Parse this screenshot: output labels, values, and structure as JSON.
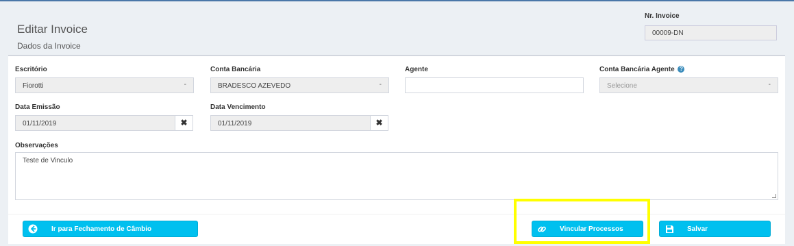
{
  "header": {
    "title": "Editar Invoice",
    "subtitle": "Dados da Invoice",
    "nr_invoice_label": "Nr. Invoice",
    "nr_invoice_value": "00009-DN"
  },
  "form": {
    "escritorio_label": "Escritório",
    "escritorio_value": "Fiorotti",
    "conta_bancaria_label": "Conta Bancária",
    "conta_bancaria_value": "BRADESCO AZEVEDO",
    "agente_label": "Agente",
    "agente_value": "",
    "conta_agente_label": "Conta Bancária Agente",
    "conta_agente_placeholder": "Selecione",
    "select_caret": "-",
    "data_emissao_label": "Data Emissão",
    "data_emissao_value": "01/11/2019",
    "data_vencimento_label": "Data Vencimento",
    "data_vencimento_value": "01/11/2019",
    "clear_glyph": "✖",
    "observacoes_label": "Observações",
    "observacoes_value": "Teste de Vinculo"
  },
  "footer": {
    "cambio_label": "Ir para Fechamento de Câmbio",
    "vincular_label": "Vincular Processos",
    "salvar_label": "Salvar"
  },
  "icons": {
    "help": "help-icon",
    "back": "arrow-left-circle-icon",
    "link": "link-icon",
    "save": "floppy-disk-icon"
  },
  "colors": {
    "accent": "#00c0ef",
    "highlight": "#ffff00",
    "help": "#3c8dbc"
  }
}
